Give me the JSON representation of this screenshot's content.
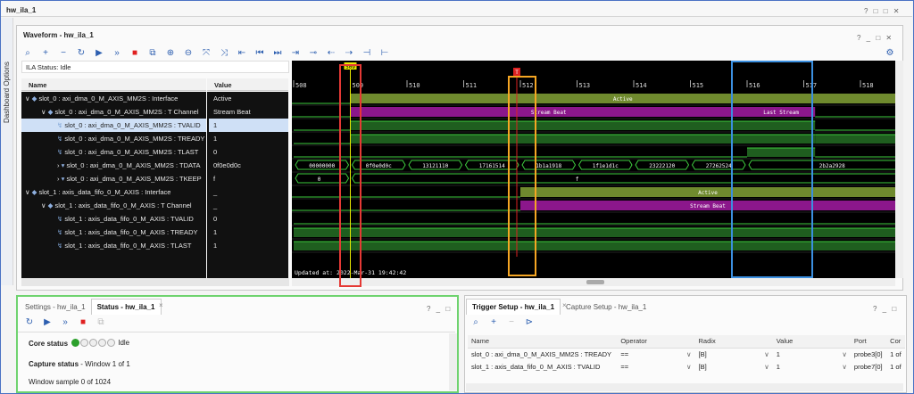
{
  "window_title": "hw_ila_1",
  "window_controls": "? □ □ ✕",
  "dashboard_options": "Dashboard Options",
  "waveform": {
    "title": "Waveform - hw_ila_1",
    "controls": "? _ □ ✕",
    "ila_status": "ILA Status:  Idle",
    "col_name": "Name",
    "col_value": "Value",
    "toolbar_icons": [
      "search-icon",
      "add-icon",
      "minus-icon",
      "refresh-icon",
      "run-icon",
      "run-immediate-icon",
      "stop-icon",
      "export-icon",
      "zoom-in-icon",
      "zoom-out-icon",
      "zoom-fit-icon",
      "swap-icon",
      "go-start-icon",
      "prev-icon",
      "next-icon",
      "go-end-icon",
      "add-marker-icon",
      "prev-transition-icon",
      "next-transition-icon",
      "marker-icon",
      "snap-icon",
      "gear-icon"
    ],
    "signals": [
      {
        "name": "slot_0 : axi_dma_0_M_AXIS_MM2S : Interface",
        "value": "Active",
        "indent": 0,
        "expand": "∨",
        "icon": "interface"
      },
      {
        "name": "slot_0 : axi_dma_0_M_AXIS_MM2S : T Channel",
        "value": "Stream Beat",
        "indent": 1,
        "expand": "∨",
        "icon": "channel"
      },
      {
        "name": "slot_0 : axi_dma_0_M_AXIS_MM2S : TVALID",
        "value": "1",
        "indent": 2,
        "expand": "",
        "icon": "bit",
        "selected": true
      },
      {
        "name": "slot_0 : axi_dma_0_M_AXIS_MM2S : TREADY",
        "value": "1",
        "indent": 2,
        "expand": "",
        "icon": "bit"
      },
      {
        "name": "slot_0 : axi_dma_0_M_AXIS_MM2S : TLAST",
        "value": "0",
        "indent": 2,
        "expand": "",
        "icon": "bit"
      },
      {
        "name": "slot_0 : axi_dma_0_M_AXIS_MM2S : TDATA",
        "value": "0f0e0d0c",
        "indent": 2,
        "expand": "›",
        "icon": "bus"
      },
      {
        "name": "slot_0 : axi_dma_0_M_AXIS_MM2S : TKEEP",
        "value": "f",
        "indent": 2,
        "expand": "›",
        "icon": "bus"
      },
      {
        "name": "slot_1 : axis_data_fifo_0_M_AXIS : Interface",
        "value": "_",
        "indent": 0,
        "expand": "∨",
        "icon": "interface"
      },
      {
        "name": "slot_1 : axis_data_fifo_0_M_AXIS : T Channel",
        "value": "_",
        "indent": 1,
        "expand": "∨",
        "icon": "channel"
      },
      {
        "name": "slot_1 : axis_data_fifo_0_M_AXIS : TVALID",
        "value": "0",
        "indent": 2,
        "expand": "",
        "icon": "bit"
      },
      {
        "name": "slot_1 : axis_data_fifo_0_M_AXIS : TREADY",
        "value": "1",
        "indent": 2,
        "expand": "",
        "icon": "bit"
      },
      {
        "name": "slot_1 : axis_data_fifo_0_M_AXIS : TLAST",
        "value": "1",
        "indent": 2,
        "expand": "",
        "icon": "bit"
      }
    ],
    "ruler_ticks": [
      "508",
      "509",
      "510",
      "511",
      "512",
      "513",
      "514",
      "515",
      "516",
      "517",
      "518"
    ],
    "cursor_label": "509",
    "marker_label": "T",
    "labels": {
      "active": "Active",
      "stream_beat": "Stream Beat",
      "last_stream": "Last Stream"
    },
    "tdata": [
      "00000000",
      "0f0e0d0c",
      "13121110",
      "17161514",
      "1b1a1918",
      "1f1e1d1c",
      "23222120",
      "27262524",
      "2b2a2928"
    ],
    "tkeep": [
      "0",
      "f"
    ],
    "updated": "Updated at: 2022-Mar-31 19:42:42",
    "colors": {
      "accent": "#2d5fb0",
      "active": "#6f8a2e",
      "stream": "#8b178b",
      "wave": "#3ecb3e",
      "bus": "#3a7a3a",
      "red_box": "#e53935",
      "orange_box": "#f5a623",
      "blue_box": "#3b8fe0",
      "green_box": "#6fd36f"
    }
  },
  "status_panel": {
    "tabs": [
      "Settings - hw_ila_1",
      "Status - hw_ila_1"
    ],
    "controls": "? _ □",
    "core_status_label": "Core status",
    "core_status_value": "Idle",
    "capture_status_label": "Capture status",
    "capture_status_value": "Window 1 of 1",
    "window_sample": "Window sample 0 of 1024"
  },
  "trigger_panel": {
    "tabs": [
      "Trigger Setup - hw_ila_1",
      "Capture Setup - hw_ila_1"
    ],
    "controls": "? _ □",
    "columns": [
      "Name",
      "Operator",
      "Radix",
      "Value",
      "Port",
      "Cor"
    ],
    "rows": [
      {
        "name": "slot_0 : axi_dma_0_M_AXIS_MM2S : TREADY",
        "operator": "==",
        "radix": "[B]",
        "value": "1",
        "port": "probe3[0]",
        "cor": "1 of"
      },
      {
        "name": "slot_1 : axis_data_fifo_0_M_AXIS : TVALID",
        "operator": "==",
        "radix": "[B]",
        "value": "1",
        "port": "probe7[0]",
        "cor": "1 of"
      }
    ]
  }
}
